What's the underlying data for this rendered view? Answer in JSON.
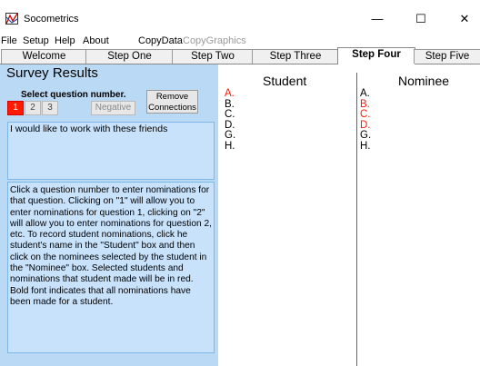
{
  "window": {
    "title": "Socometrics",
    "minimize": "—",
    "maximize": "☐",
    "close": "✕"
  },
  "menu": [
    "File",
    "Setup",
    "Help",
    "About",
    "CopyData",
    "CopyGraphics"
  ],
  "tabs": [
    "Welcome",
    "Step One",
    "Step Two",
    "Step Three",
    "Step Four",
    "Step Five"
  ],
  "active_tab": "Step Four",
  "left": {
    "title": "Survey Results",
    "select_label": "Select question number.",
    "questions": [
      "1",
      "2",
      "3"
    ],
    "selected_question": "1",
    "negative_label": "Negative",
    "remove_line1": "Remove",
    "remove_line2": "Connections",
    "question_text": "I would like to work with these friends",
    "help_text": "Click a question number to enter nominations for that question.  Clicking on \"1\" will allow you to enter nominations for question 1, clicking on \"2\" will allow you to enter nominations for question 2, etc.  To record student nominations, click he student's name in the \"Student\" box and then click on the nominees selected by the student in the \"Nominee\" box.  Selected students and nominations that student made will be in red.  Bold font indicates that all nominations have been made for a student."
  },
  "student": {
    "header": "Student",
    "items": [
      "A.",
      "B.",
      "C.",
      "D.",
      "G.",
      "H."
    ]
  },
  "nominee": {
    "header": "Nominee",
    "items": [
      "A.",
      "B.",
      "C.",
      "D.",
      "G.",
      "H."
    ]
  },
  "colors": {
    "selected": "#ff1a00",
    "panel_bg": "#b9d9f5",
    "box_bg": "#c8e2fb"
  }
}
